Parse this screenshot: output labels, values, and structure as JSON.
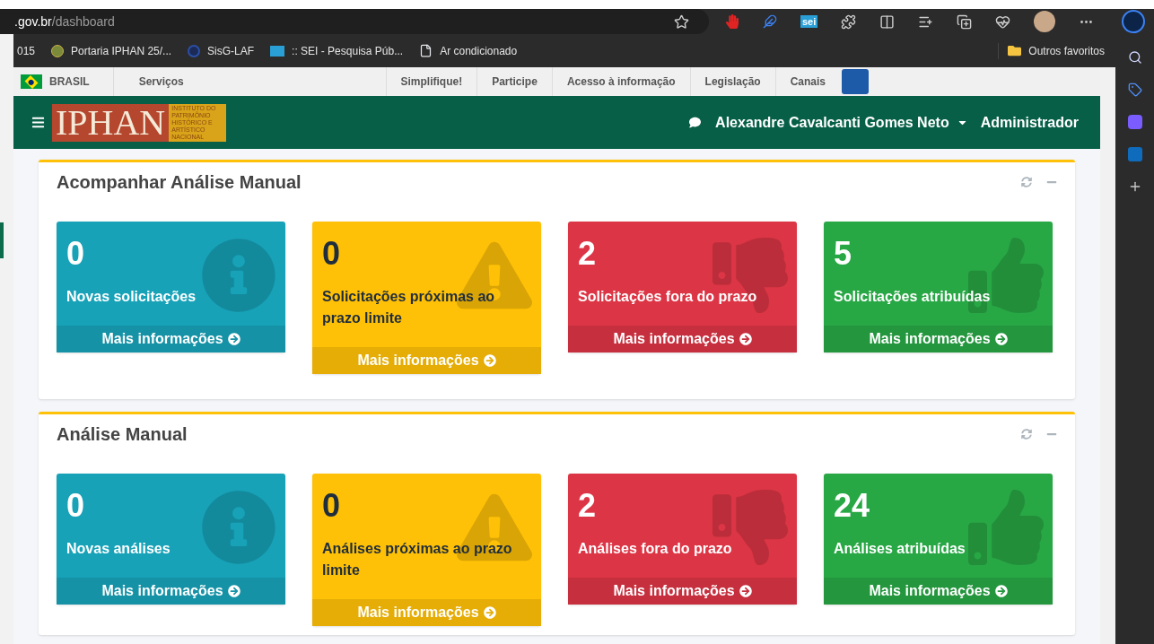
{
  "browser": {
    "address_host": ".gov.br",
    "address_path": "/dashboard",
    "bookmarks": [
      {
        "kind": "plain",
        "label": "015"
      },
      {
        "kind": "seal",
        "label": "Portaria IPHAN 25/..."
      },
      {
        "kind": "target",
        "label": "SisG-LAF"
      },
      {
        "kind": "sei",
        "label": ":: SEI - Pesquisa Púb..."
      },
      {
        "kind": "page",
        "label": "Ar condicionado"
      }
    ],
    "other_favorites": "Outros favoritos",
    "sei_badge": "sei"
  },
  "gov_bar": {
    "brand": "BRASIL",
    "services": "Serviços",
    "links": [
      "Simplifique!",
      "Participe",
      "Acesso à informação",
      "Legislação",
      "Canais"
    ]
  },
  "header": {
    "logo": "IPHAN",
    "logo_subtitle": "INSTITUTO DO PATRIMÔNIO HISTÓRICO E ARTÍSTICO NACIONAL",
    "user": "Alexandre Cavalcanti Gomes Neto",
    "role": "Administrador"
  },
  "panels": [
    {
      "title": "Acompanhar Análise Manual",
      "cards": [
        {
          "kind": "info",
          "count": "0",
          "label": "Novas solicitações",
          "link": "Mais informações"
        },
        {
          "kind": "warning",
          "count": "0",
          "label": "Solicitações próximas ao prazo limite",
          "link": "Mais informações"
        },
        {
          "kind": "danger",
          "count": "2",
          "label": "Solicitações fora do prazo",
          "link": "Mais informações"
        },
        {
          "kind": "success",
          "count": "5",
          "label": "Solicitações atribuídas",
          "link": "Mais informações"
        }
      ]
    },
    {
      "title": "Análise Manual",
      "cards": [
        {
          "kind": "info",
          "count": "0",
          "label": "Novas análises",
          "link": "Mais informações"
        },
        {
          "kind": "warning",
          "count": "0",
          "label": "Análises próximas ao prazo limite",
          "link": "Mais informações"
        },
        {
          "kind": "danger",
          "count": "2",
          "label": "Análises fora do prazo",
          "link": "Mais informações"
        },
        {
          "kind": "success",
          "count": "24",
          "label": "Análises atribuídas",
          "link": "Mais informações"
        }
      ]
    }
  ]
}
